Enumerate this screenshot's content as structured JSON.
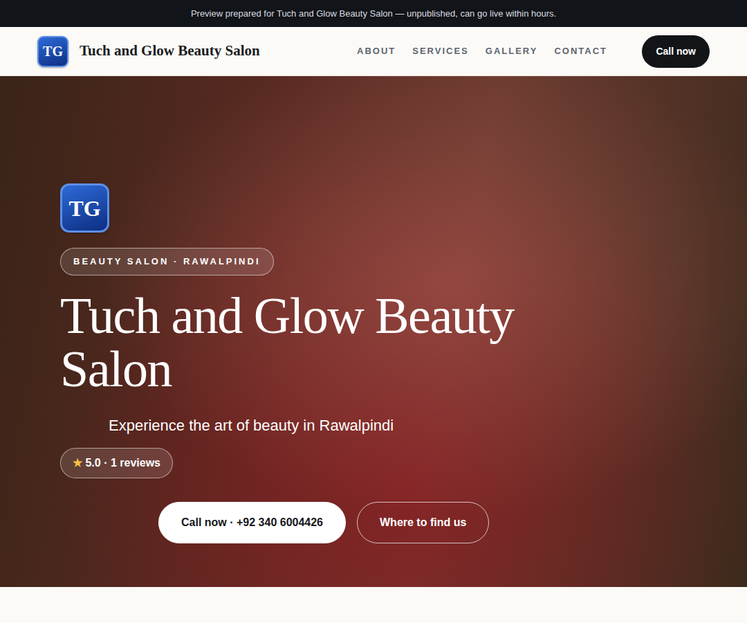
{
  "banner": {
    "text": "Preview prepared for Tuch and Glow Beauty Salon — unpublished, can go live within hours."
  },
  "nav": {
    "logo": "TG",
    "brand": "Tuch and Glow Beauty Salon",
    "links": [
      "ABOUT",
      "SERVICES",
      "GALLERY",
      "CONTACT"
    ],
    "cta": "Call now"
  },
  "hero": {
    "logo": "TG",
    "tag": "BEAUTY SALON · RAWALPINDI",
    "title": "Tuch and Glow Beauty Salon",
    "subtitle": "Experience the art of beauty in Rawalpindi",
    "rating": {
      "star": "★",
      "text": "5.0 · 1 reviews"
    },
    "buttons": [
      "Call now · +92 340 6004426",
      "Where to find us"
    ]
  }
}
